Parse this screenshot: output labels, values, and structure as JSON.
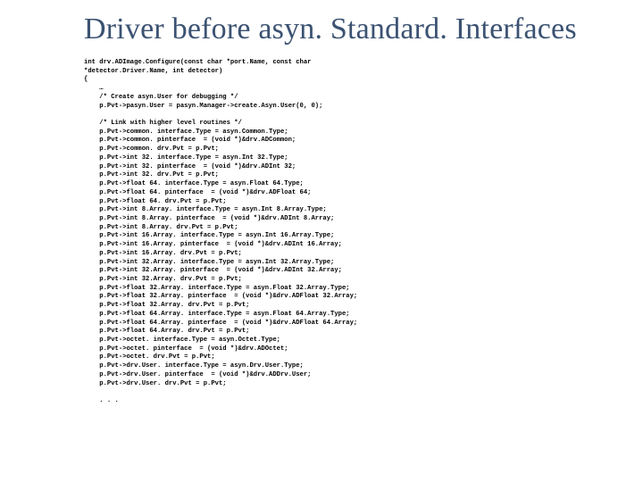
{
  "title": "Driver before asyn. Standard. Interfaces",
  "code": "int drv.ADImage.Configure(const char *port.Name, const char\n*detector.Driver.Name, int detector)\n{\n    …\n    /* Create asyn.User for debugging */\n    p.Pvt->pasyn.User = pasyn.Manager->create.Asyn.User(0, 0);\n\n    /* Link with higher level routines */\n    p.Pvt->common. interface.Type = asyn.Common.Type;\n    p.Pvt->common. pinterface  = (void *)&drv.ADCommon;\n    p.Pvt->common. drv.Pvt = p.Pvt;\n    p.Pvt->int 32. interface.Type = asyn.Int 32.Type;\n    p.Pvt->int 32. pinterface  = (void *)&drv.ADInt 32;\n    p.Pvt->int 32. drv.Pvt = p.Pvt;\n    p.Pvt->float 64. interface.Type = asyn.Float 64.Type;\n    p.Pvt->float 64. pinterface  = (void *)&drv.ADFloat 64;\n    p.Pvt->float 64. drv.Pvt = p.Pvt;\n    p.Pvt->int 8.Array. interface.Type = asyn.Int 8.Array.Type;\n    p.Pvt->int 8.Array. pinterface  = (void *)&drv.ADInt 8.Array;\n    p.Pvt->int 8.Array. drv.Pvt = p.Pvt;\n    p.Pvt->int 16.Array. interface.Type = asyn.Int 16.Array.Type;\n    p.Pvt->int 16.Array. pinterface  = (void *)&drv.ADInt 16.Array;\n    p.Pvt->int 16.Array. drv.Pvt = p.Pvt;\n    p.Pvt->int 32.Array. interface.Type = asyn.Int 32.Array.Type;\n    p.Pvt->int 32.Array. pinterface  = (void *)&drv.ADInt 32.Array;\n    p.Pvt->int 32.Array. drv.Pvt = p.Pvt;\n    p.Pvt->float 32.Array. interface.Type = asyn.Float 32.Array.Type;\n    p.Pvt->float 32.Array. pinterface  = (void *)&drv.ADFloat 32.Array;\n    p.Pvt->float 32.Array. drv.Pvt = p.Pvt;\n    p.Pvt->float 64.Array. interface.Type = asyn.Float 64.Array.Type;\n    p.Pvt->float 64.Array. pinterface  = (void *)&drv.ADFloat 64.Array;\n    p.Pvt->float 64.Array. drv.Pvt = p.Pvt;\n    p.Pvt->octet. interface.Type = asyn.Octet.Type;\n    p.Pvt->octet. pinterface  = (void *)&drv.ADOctet;\n    p.Pvt->octet. drv.Pvt = p.Pvt;\n    p.Pvt->drv.User. interface.Type = asyn.Drv.User.Type;\n    p.Pvt->drv.User. pinterface  = (void *)&drv.ADDrv.User;\n    p.Pvt->drv.User. drv.Pvt = p.Pvt;\n\n    . . ."
}
